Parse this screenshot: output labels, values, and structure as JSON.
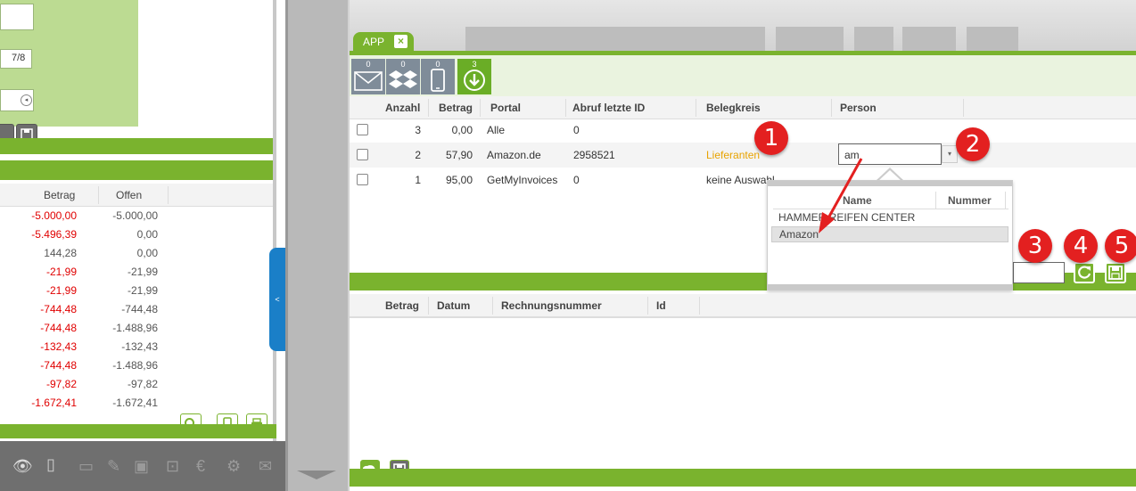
{
  "left": {
    "field_value": "7/8",
    "table": {
      "headers": [
        "Betrag",
        "Offen"
      ],
      "rows": [
        {
          "betrag": "-5.000,00",
          "offen": "-5.000,00",
          "neg": true
        },
        {
          "betrag": "-5.496,39",
          "offen": "0,00",
          "neg": true
        },
        {
          "betrag": "144,28",
          "offen": "0,00",
          "neg": false
        },
        {
          "betrag": "-21,99",
          "offen": "-21,99",
          "neg": true
        },
        {
          "betrag": "-21,99",
          "offen": "-21,99",
          "neg": true
        },
        {
          "betrag": "-744,48",
          "offen": "-744,48",
          "neg": true
        },
        {
          "betrag": "-744,48",
          "offen": "-1.488,96",
          "neg": true
        },
        {
          "betrag": "-132,43",
          "offen": "-132,43",
          "neg": true
        },
        {
          "betrag": "-744,48",
          "offen": "-1.488,96",
          "neg": true
        },
        {
          "betrag": "-97,82",
          "offen": "-97,82",
          "neg": true
        },
        {
          "betrag": "-1.672,41",
          "offen": "-1.672,41",
          "neg": true
        }
      ]
    },
    "handle_label": "<"
  },
  "app_tab": {
    "label": "APP",
    "close": "×"
  },
  "sources": [
    {
      "name": "email",
      "count": "0"
    },
    {
      "name": "dropbox",
      "count": "0"
    },
    {
      "name": "mobile",
      "count": "0"
    },
    {
      "name": "download",
      "count": "3"
    }
  ],
  "top_table": {
    "headers": [
      "Anzahl",
      "Betrag",
      "Portal",
      "Abruf letzte ID",
      "Belegkreis",
      "Person"
    ],
    "rows": [
      {
        "anzahl": "3",
        "betrag": "0,00",
        "portal": "Alle",
        "abruf": "0",
        "belegkreis": ""
      },
      {
        "anzahl": "2",
        "betrag": "57,90",
        "portal": "Amazon.de",
        "abruf": "2958521",
        "belegkreis": "Lieferanten"
      },
      {
        "anzahl": "1",
        "betrag": "95,00",
        "portal": "GetMyInvoices",
        "abruf": "0",
        "belegkreis": "keine Auswahl"
      }
    ]
  },
  "person_input": {
    "value": "am"
  },
  "dropdown": {
    "headers": [
      "Name",
      "Nummer"
    ],
    "items": [
      "HAMMER REIFEN CENTER",
      "Amazon"
    ]
  },
  "bottom_table": {
    "headers": [
      "Betrag",
      "Datum",
      "Rechnungsnummer",
      "Id"
    ]
  },
  "badges": [
    "1",
    "2",
    "3",
    "4",
    "5"
  ],
  "colors": {
    "green": "#7ab32e",
    "red_badge": "#e32020",
    "neg": "#e00000",
    "orange": "#e8a300"
  }
}
